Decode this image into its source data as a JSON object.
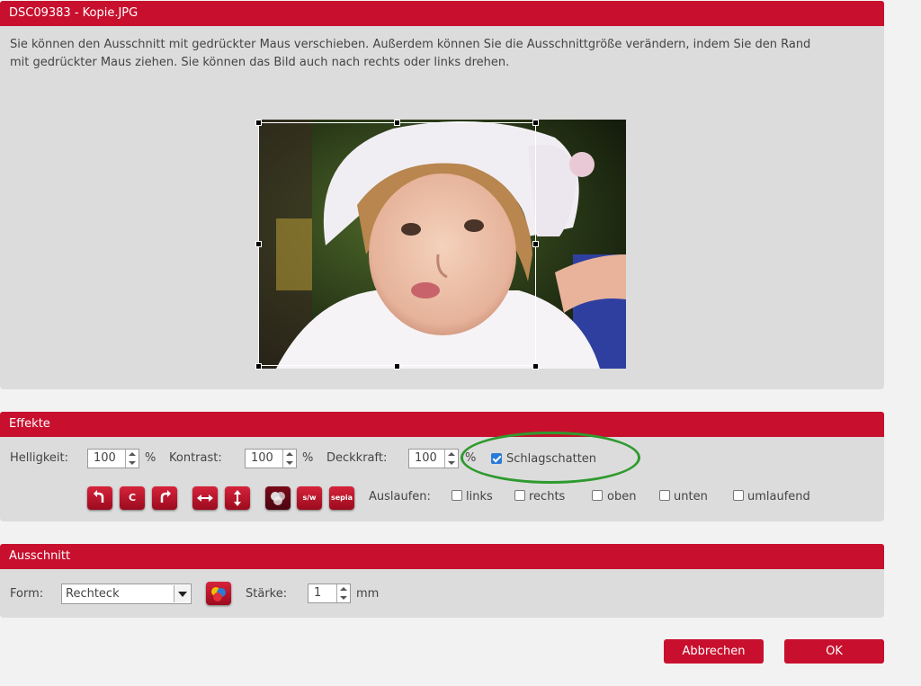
{
  "window": {
    "title": "DSC09383 - Kopie.JPG"
  },
  "description": "Sie können den Ausschnitt mit gedrückter Maus verschieben. Außerdem können Sie die Ausschnittgröße verändern, indem Sie den Rand mit gedrückter Maus ziehen. Sie können das Bild auch nach rechts oder links drehen.",
  "effects": {
    "title": "Effekte",
    "brightness": {
      "label": "Helligkeit:",
      "value": "100",
      "unit": "%"
    },
    "contrast": {
      "label": "Kontrast:",
      "value": "100",
      "unit": "%"
    },
    "opacity": {
      "label": "Deckkraft:",
      "value": "100",
      "unit": "%"
    },
    "shadow": {
      "label": "Schlagschatten",
      "checked": true
    },
    "tools": {
      "color_label": "C",
      "bw_label": "s/w",
      "sepia_label": "sepia"
    },
    "fade": {
      "label": "Auslaufen:",
      "options": [
        {
          "label": "links",
          "checked": false
        },
        {
          "label": "rechts",
          "checked": false
        },
        {
          "label": "oben",
          "checked": false
        },
        {
          "label": "unten",
          "checked": false
        },
        {
          "label": "umlaufend",
          "checked": false
        }
      ]
    }
  },
  "crop": {
    "title": "Ausschnitt",
    "form_label": "Form:",
    "form_value": "Rechteck",
    "strength_label": "Stärke:",
    "strength_value": "1",
    "strength_unit": "mm"
  },
  "buttons": {
    "cancel": "Abbrechen",
    "ok": "OK"
  },
  "colors": {
    "accent": "#c8102e",
    "highlight": "#2e9a2e",
    "checkbox": "#2a7bd6"
  }
}
